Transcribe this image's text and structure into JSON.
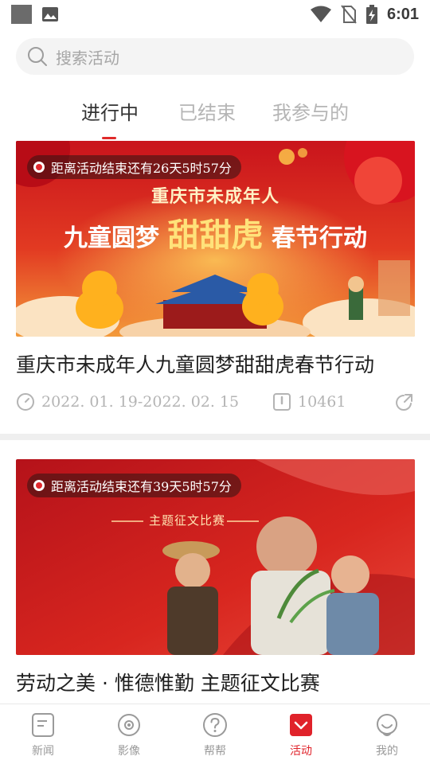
{
  "status_bar": {
    "time": "6:01",
    "icons": [
      "app-square-icon",
      "image-icon",
      "wifi-icon",
      "no-sim-icon",
      "battery-charging-icon"
    ]
  },
  "search": {
    "placeholder": "搜索活动",
    "icon": "search-icon"
  },
  "tabs": [
    {
      "label": "进行中",
      "active": true
    },
    {
      "label": "已结束",
      "active": false
    },
    {
      "label": "我参与的",
      "active": false
    }
  ],
  "accent_color": "#e0222a",
  "activities": [
    {
      "countdown": "距离活动结束还有26天5时57分",
      "banner_subtitle": "重庆市未成年人",
      "banner_title_left": "九童圆梦",
      "banner_title_highlight": "甜甜虎",
      "banner_title_right": "春节行动",
      "title": "重庆市未成年人九童圆梦甜甜虎春节行动",
      "date_range": "2022. 01. 19-2022. 02. 15",
      "views": "10461"
    },
    {
      "countdown": "距离活动结束还有39天5时57分",
      "banner_subtitle": "主题征文比赛",
      "title": "劳动之美 · 惟德惟勤  主题征文比赛"
    }
  ],
  "bottom_nav": [
    {
      "label": "新闻",
      "icon": "news-icon",
      "active": false
    },
    {
      "label": "影像",
      "icon": "video-icon",
      "active": false
    },
    {
      "label": "帮帮",
      "icon": "help-icon",
      "active": false
    },
    {
      "label": "活动",
      "icon": "activity-icon",
      "active": true
    },
    {
      "label": "我的",
      "icon": "profile-icon",
      "active": false
    }
  ]
}
